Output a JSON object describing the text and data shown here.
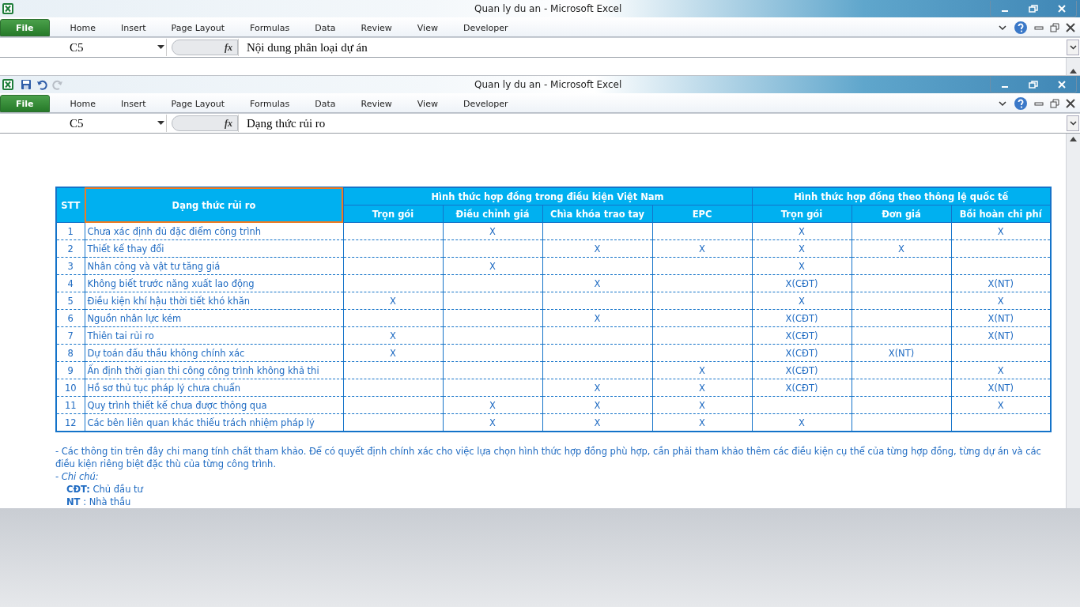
{
  "windows": [
    {
      "title": "Quan ly du an  -  Microsoft Excel",
      "menu_tabs": [
        {
          "label": "File",
          "selected": true
        },
        {
          "label": "Home",
          "selected": false
        },
        {
          "label": "Insert",
          "selected": false
        },
        {
          "label": "Page Layout",
          "selected": false
        },
        {
          "label": "Formulas",
          "selected": false
        },
        {
          "label": "Data",
          "selected": false
        },
        {
          "label": "Review",
          "selected": false
        },
        {
          "label": "View",
          "selected": false
        },
        {
          "label": "Developer",
          "selected": false
        }
      ],
      "name_box": "C5",
      "function_label": "fx",
      "formula": "Nội dung phân loại dự án"
    },
    {
      "title": "Quan ly du an  -  Microsoft Excel",
      "menu_tabs": [
        {
          "label": "File",
          "selected": true
        },
        {
          "label": "Home",
          "selected": false
        },
        {
          "label": "Insert",
          "selected": false
        },
        {
          "label": "Page Layout",
          "selected": false
        },
        {
          "label": "Formulas",
          "selected": false
        },
        {
          "label": "Data",
          "selected": false
        },
        {
          "label": "Review",
          "selected": false
        },
        {
          "label": "View",
          "selected": false
        },
        {
          "label": "Developer",
          "selected": false
        }
      ],
      "name_box": "C5",
      "function_label": "fx",
      "formula": "Dạng thức rủi ro"
    }
  ],
  "table": {
    "stt_header": "STT",
    "risk_header": {
      "label": "Dạng thức rủi ro",
      "selected": true
    },
    "groups": [
      {
        "label": "Hình thức hợp đồng trong điều kiện Việt Nam",
        "columns": [
          "Trọn gói",
          "Điều chỉnh giá",
          "Chìa khóa trao tay",
          "EPC"
        ]
      },
      {
        "label": "Hình thức hợp đồng theo thông lệ quốc tế",
        "columns": [
          "Trọn gói",
          "Đơn giá",
          "Bồi hoàn chi phí"
        ]
      }
    ],
    "rows": [
      {
        "stt": "1",
        "risk": "Chưa xác định đủ đặc điểm công trình",
        "cells": [
          null,
          "X",
          null,
          null,
          "X",
          null,
          "X"
        ]
      },
      {
        "stt": "2",
        "risk": "Thiết kế thay đổi",
        "cells": [
          null,
          null,
          "X",
          "X",
          "X",
          "X",
          null
        ]
      },
      {
        "stt": "3",
        "risk": "Nhân công và vật tư tăng giá",
        "cells": [
          null,
          "X",
          null,
          null,
          "X",
          null,
          null
        ]
      },
      {
        "stt": "4",
        "risk": "Không biết trước năng xuất lao động",
        "cells": [
          null,
          null,
          "X",
          null,
          "X(CĐT)",
          null,
          "X(NT)"
        ]
      },
      {
        "stt": "5",
        "risk": "Điều kiện khí hậu thời tiết khó khăn",
        "cells": [
          "X",
          null,
          null,
          null,
          "X",
          null,
          "X"
        ]
      },
      {
        "stt": "6",
        "risk": "Nguồn nhân lực kém",
        "cells": [
          null,
          null,
          "X",
          null,
          "X(CĐT)",
          null,
          "X(NT)"
        ]
      },
      {
        "stt": "7",
        "risk": "Thiên tai rủi ro",
        "cells": [
          "X",
          null,
          null,
          null,
          "X(CĐT)",
          null,
          "X(NT)"
        ]
      },
      {
        "stt": "8",
        "risk": "Dự toán đấu thầu không chính xác",
        "cells": [
          "X",
          null,
          null,
          null,
          "X(CĐT)",
          "X(NT)",
          null
        ]
      },
      {
        "stt": "9",
        "risk": "Ấn định thời gian thi công công trình không khả thi",
        "cells": [
          null,
          null,
          null,
          "X",
          "X(CĐT)",
          null,
          "X"
        ]
      },
      {
        "stt": "10",
        "risk": "Hồ sơ thủ tục pháp lý chưa chuẩn",
        "cells": [
          null,
          null,
          "X",
          "X",
          "X(CĐT)",
          null,
          "X(NT)"
        ]
      },
      {
        "stt": "11",
        "risk": "Quy trình thiết kế chưa được thông qua",
        "cells": [
          null,
          "X",
          "X",
          "X",
          null,
          null,
          "X"
        ]
      },
      {
        "stt": "12",
        "risk": "Các bên liên quan khác thiếu trách nhiệm pháp lý",
        "cells": [
          null,
          "X",
          "X",
          "X",
          "X",
          null,
          null
        ]
      }
    ]
  },
  "notes": {
    "paragraph": "- Các thông tin trên đây chi mang tính chất tham khảo. Để có quyết định chính xác cho việc lựa chọn hình thức hợp đồng phù hợp, cần phải tham khảo thêm các điều kiện cụ thể của từng hợp đồng, từng dự án và các điều kiện riêng biệt đặc thù của từng công trình.",
    "legend_title": "- Chi chú:",
    "legend": [
      "**CĐT:** Chủ đầu tư",
      "**NT**  : Nhà thầu"
    ]
  }
}
